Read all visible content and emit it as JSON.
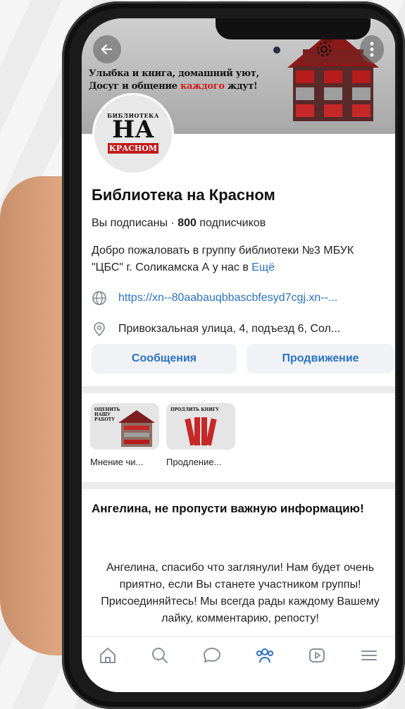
{
  "cover": {
    "line1": "Улыбка и книга, домашний уют,",
    "line2_a": "Досуг и общение ",
    "line2_b": "каждого",
    "line2_c": " ждут!"
  },
  "avatar": {
    "l1": "БИБЛИОТЕКА",
    "l2": "НА",
    "l3": "КРАСНОМ"
  },
  "group": {
    "title": "Библиотека на Красном",
    "subscribed": "Вы подписаны",
    "dot": " · ",
    "count": "800",
    "count_label": " подписчиков",
    "description": "Добро пожаловать в группу библиотеки №3 МБУК \"ЦБС\" г. Соликамска А у нас в ",
    "more": "Ещё",
    "link": "https://xn--80aabauqbbascbfesyd7cgj.xn--...",
    "address": "Привокзальная улица, 4, подъезд 6, Сол..."
  },
  "buttons": {
    "messages": "Сообщения",
    "promotion": "Продвижение"
  },
  "widgets": [
    {
      "caption": "Мнение чи...",
      "thumb_text": "ОЦЕНИТЬ НАШУ РАБОТУ"
    },
    {
      "caption": "Продление...",
      "thumb_text": "ПРОДЛИТЬ КНИГУ"
    }
  ],
  "post": {
    "title": "Ангелина, не пропусти важную информацию!",
    "body": "Ангелина, спасибо что заглянули! Нам будет очень приятно, если Вы станете участником группы! Присоединяйтесь! Мы всегда рады каждому Вашему лайку, комментарию, репосту!"
  },
  "tabs": [
    "home-icon",
    "search-icon",
    "chat-icon",
    "community-icon",
    "video-icon",
    "menu-icon"
  ],
  "colors": {
    "accent": "#2a72c9",
    "brand_red": "#c21b1b"
  }
}
